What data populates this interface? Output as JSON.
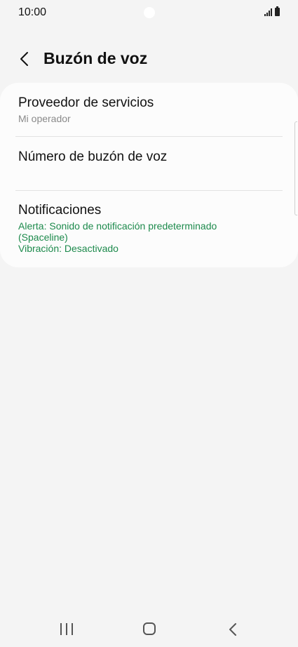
{
  "status_bar": {
    "time": "10:00",
    "icons": [
      "signal-icon",
      "battery-icon"
    ]
  },
  "header": {
    "back_icon": "chevron-left-icon",
    "title": "Buzón de voz"
  },
  "settings": {
    "items": [
      {
        "title": "Proveedor de servicios",
        "subtitle": "Mi operador"
      },
      {
        "title": "Número de buzón de voz"
      },
      {
        "title": "Notificaciones",
        "subtitle_line1": "Alerta: Sonido de notificación predeterminado",
        "subtitle_line2": "(Spaceline)",
        "subtitle_line3": "Vibración: Desactivado"
      }
    ]
  },
  "nav_bar": {
    "icons": [
      "recents-icon",
      "home-icon",
      "back-icon"
    ]
  },
  "colors": {
    "background": "#f4f4f4",
    "card": "#fcfcfc",
    "accent_green": "#1d8a4c",
    "secondary_text": "#8a8a8a"
  }
}
